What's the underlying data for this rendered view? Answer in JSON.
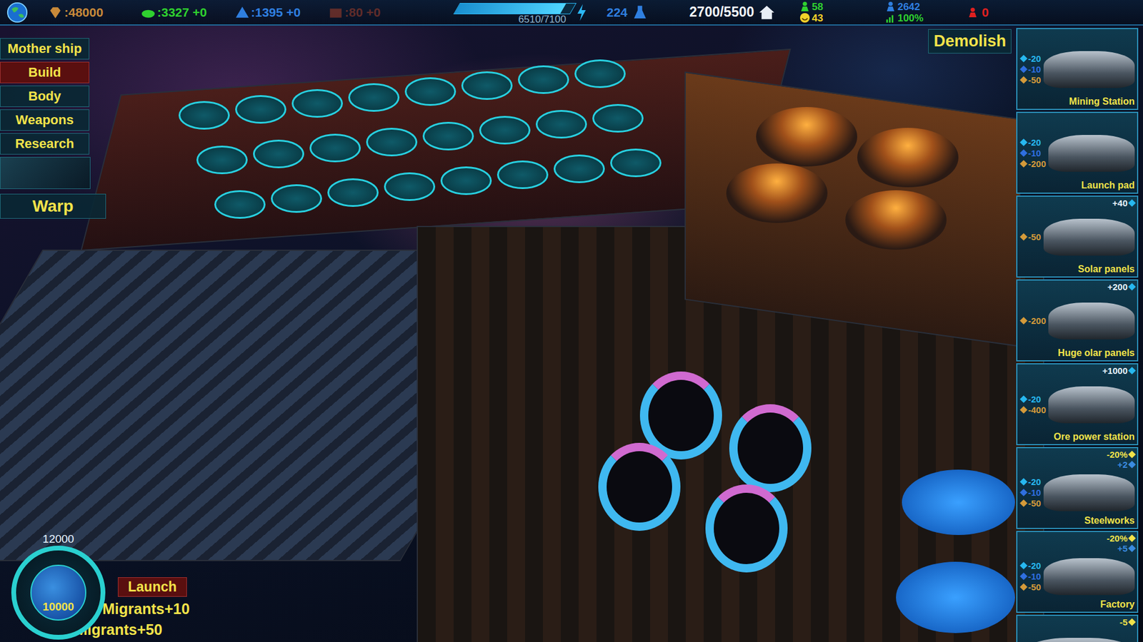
{
  "top_bar": {
    "resources": [
      {
        "kind": "gem",
        "text": ":48000",
        "color": "#c98a3a",
        "dim": false
      },
      {
        "kind": "ore",
        "text": ":3327 +0",
        "color": "#2fd12f",
        "dim": false
      },
      {
        "kind": "crystal",
        "text": ":1395 +0",
        "color": "#2f7fe0",
        "dim": false
      },
      {
        "kind": "crate",
        "text": ":80 +0",
        "color": "#a8402a",
        "dim": true
      }
    ],
    "energy": {
      "reading": "6510/7100",
      "level": 0.917
    },
    "science": "224",
    "housing": "2700/5500",
    "population": {
      "workers": "58",
      "happiness": "43"
    },
    "stats": {
      "people": "2642",
      "efficiency": "100%"
    },
    "alerts": "0"
  },
  "menu": [
    {
      "label": "Mother ship",
      "selected": false
    },
    {
      "label": "Build",
      "selected": true
    },
    {
      "label": "Body",
      "selected": false
    },
    {
      "label": "Weapons",
      "selected": false
    },
    {
      "label": "Research",
      "selected": false
    }
  ],
  "warp": "Warp",
  "demolish": "Demolish",
  "buildings": [
    {
      "name": "Mining Station",
      "gains": [],
      "costs": [
        {
          "kind": "energy",
          "text": "-20"
        },
        {
          "kind": "crystal",
          "text": "-10"
        },
        {
          "kind": "gold",
          "text": "-50"
        }
      ]
    },
    {
      "name": "Launch pad",
      "gains": [],
      "costs": [
        {
          "kind": "energy",
          "text": "-20"
        },
        {
          "kind": "crystal",
          "text": "-10"
        },
        {
          "kind": "gold",
          "text": "-200"
        }
      ]
    },
    {
      "name": "Solar panels",
      "gains": [
        {
          "kind": "energy",
          "text": "+40"
        }
      ],
      "costs": [
        {
          "kind": "gold",
          "text": "-50"
        }
      ]
    },
    {
      "name": "Huge olar panels",
      "gains": [
        {
          "kind": "energy",
          "text": "+200"
        }
      ],
      "costs": [
        {
          "kind": "gold",
          "text": "-200"
        }
      ]
    },
    {
      "name": "Ore power station",
      "gains": [
        {
          "kind": "energy",
          "text": "+1000"
        }
      ],
      "costs": [
        {
          "kind": "energy",
          "text": "-20"
        },
        {
          "kind": "gold",
          "text": "-400"
        }
      ]
    },
    {
      "name": "Steelworks",
      "gains": [
        {
          "kind": "ore",
          "text": "-20%"
        },
        {
          "kind": "steel",
          "text": "+2"
        }
      ],
      "costs": [
        {
          "kind": "energy",
          "text": "-20"
        },
        {
          "kind": "crystal",
          "text": "-10"
        },
        {
          "kind": "gold",
          "text": "-50"
        }
      ]
    },
    {
      "name": "Factory",
      "gains": [
        {
          "kind": "ore",
          "text": "-20%"
        },
        {
          "kind": "steel",
          "text": "+5"
        }
      ],
      "costs": [
        {
          "kind": "energy",
          "text": "-20"
        },
        {
          "kind": "crystal",
          "text": "-10"
        },
        {
          "kind": "gold",
          "text": "-50"
        }
      ]
    },
    {
      "name": "",
      "gains": [
        {
          "kind": "ore",
          "text": "-5"
        }
      ],
      "costs": []
    }
  ],
  "launch_panel": {
    "gauge_max": "12000",
    "gauge_value": "10000",
    "launch": "Launch",
    "migrants": [
      "Migrants+10",
      "Migrants+50"
    ]
  }
}
